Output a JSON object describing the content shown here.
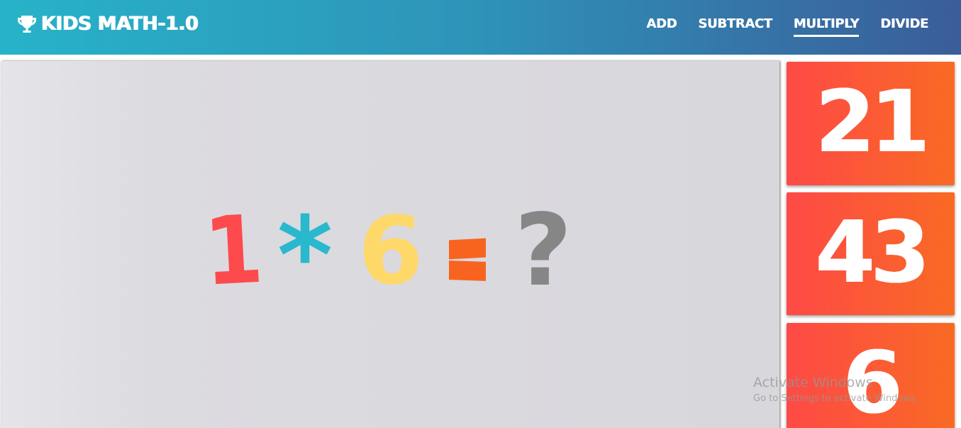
{
  "header": {
    "brand": "KIDS MATH-1.0",
    "nav": [
      {
        "label": "ADD",
        "active": false
      },
      {
        "label": "SUBTRACT",
        "active": false
      },
      {
        "label": "MULTIPLY",
        "active": true
      },
      {
        "label": "DIVIDE",
        "active": false
      }
    ]
  },
  "question": {
    "operand1": "1",
    "operator": "*",
    "operand2": "6",
    "equals": "=",
    "unknown": "?"
  },
  "answers": [
    {
      "value": "21"
    },
    {
      "value": "43"
    },
    {
      "value": "6"
    }
  ],
  "watermark": {
    "title": "Activate Windows",
    "subtitle": "Go to Settings to activate Windows."
  },
  "icons": {
    "brand_icon": "trophy-icon"
  },
  "colors": {
    "header_gradient": [
      "#27b3c9",
      "#3b5d9a"
    ],
    "operand1": "#fd4a4c",
    "operator": "#29b8cd",
    "operand2": "#fed869",
    "equals": "#f8631f",
    "unknown": "#868686",
    "answer_tile": [
      "#fe4a46",
      "#f96a24"
    ]
  }
}
